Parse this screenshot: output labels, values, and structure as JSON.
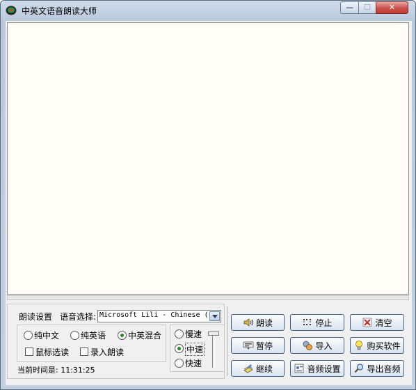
{
  "window": {
    "title": "中英文语音朗读大师",
    "controls": {
      "minimize": "—",
      "maximize": "☐",
      "close": "✕"
    }
  },
  "settings": {
    "group_label": "朗读设置",
    "voice_label": "语音选择:",
    "voice_selected": "Microsoft Lili - Chinese (",
    "language_options": [
      {
        "label": "纯中文",
        "selected": false
      },
      {
        "label": "纯英语",
        "selected": false
      },
      {
        "label": "中英混合",
        "selected": true
      }
    ],
    "checkboxes": [
      {
        "label": "鼠标选读",
        "checked": false
      },
      {
        "label": "录入朗读",
        "checked": false
      }
    ],
    "speed_options": [
      {
        "label": "慢速",
        "selected": false
      },
      {
        "label": "中速",
        "selected": true
      },
      {
        "label": "快速",
        "selected": false
      }
    ],
    "time_label": "当前时间是: 11:31:25"
  },
  "buttons": {
    "read": "朗读",
    "stop": "停止",
    "clear": "清空",
    "pause": "暂停",
    "import": "导入",
    "buy": "购买软件",
    "continue": "继续",
    "audio_settings": "音频设置",
    "export_audio": "导出音频"
  },
  "icons": {
    "read": "speaker-icon",
    "stop": "stop-dots-icon",
    "clear": "clear-icon",
    "pause": "pause-icon",
    "import": "import-icon",
    "buy": "lightbulb-icon",
    "continue": "continue-icon",
    "audio_settings": "audio-settings-icon",
    "export_audio": "magnifier-icon"
  },
  "colors": {
    "text_area_bg": "#fffdf5",
    "radio_selected": "#1a8d1a",
    "close_button": "#c75050"
  }
}
